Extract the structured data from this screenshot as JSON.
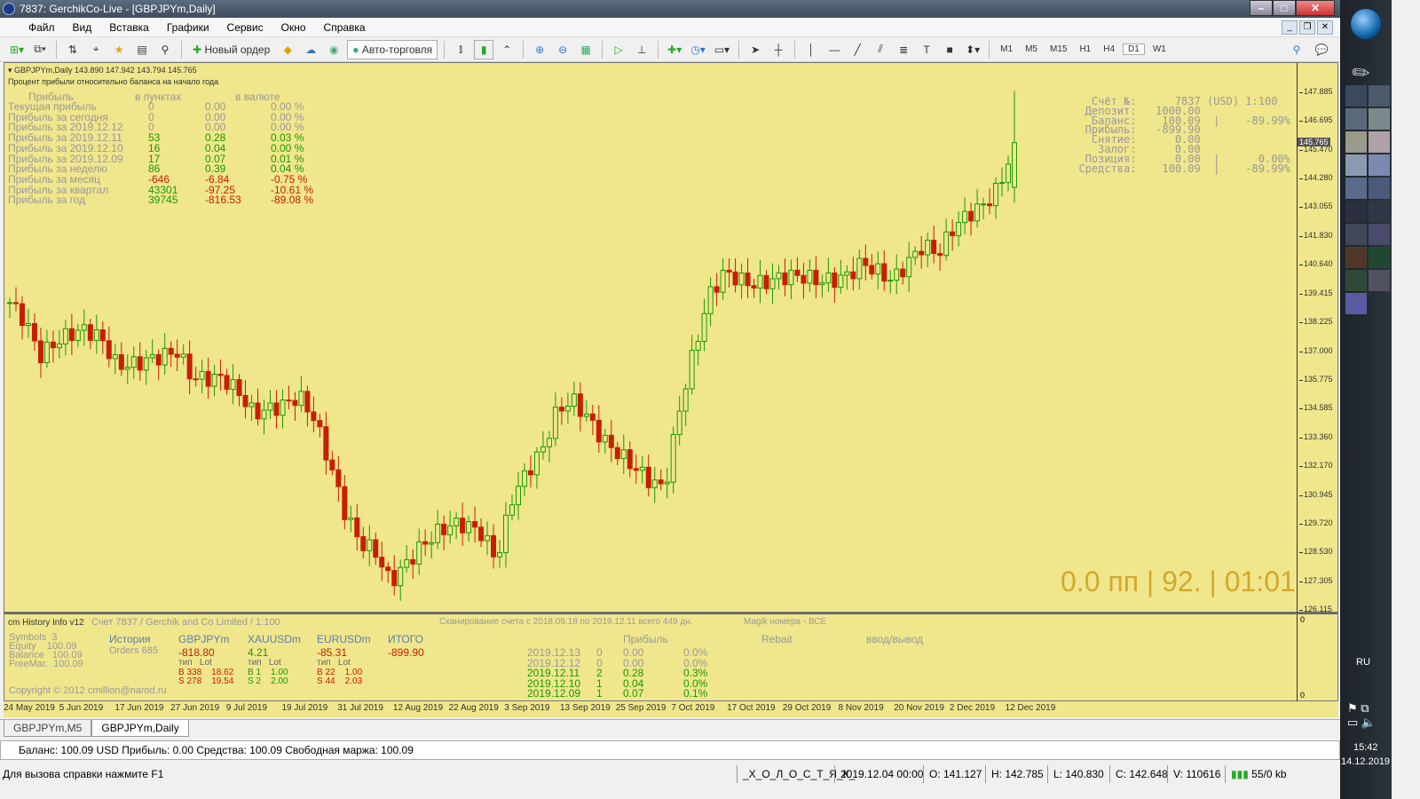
{
  "window": {
    "title": "7837: GerchikCo-Live - [GBPJPYm,Daily]"
  },
  "menu": [
    "Файл",
    "Вид",
    "Вставка",
    "Графики",
    "Сервис",
    "Окно",
    "Справка"
  ],
  "toolbar": {
    "new_order": "Новый ордер",
    "auto_trading": "Авто-торговля",
    "timeframes": [
      "M1",
      "M5",
      "M15",
      "H1",
      "H4",
      "D1",
      "W1"
    ],
    "active_timeframe": "D1"
  },
  "chart_header": {
    "symbol_line": "GBPJPYm,Daily  143.890 147.942 143.794 145.765",
    "subtitle": "Процент прибыли относительно баланса на начало года"
  },
  "profit_table": {
    "headers": [
      "Прибыль",
      "в пунктах",
      "в валюте"
    ],
    "rows": [
      {
        "label": "Текущая прибыль",
        "points": "0",
        "money": "0.00",
        "pct": "0.00 %",
        "tone": "g"
      },
      {
        "label": "Прибыль за сегодня",
        "points": "0",
        "money": "0.00",
        "pct": "0.00 %",
        "tone": "g"
      },
      {
        "label": "Прибыль за 2019.12.12",
        "points": "0",
        "money": "0.00",
        "pct": "0.00 %",
        "tone": "g"
      },
      {
        "label": "Прибыль за 2019.12.11",
        "points": "53",
        "money": "0.28",
        "pct": "0.03 %",
        "tone": "gr"
      },
      {
        "label": "Прибыль за 2019.12.10",
        "points": "16",
        "money": "0.04",
        "pct": "0.00 %",
        "tone": "gr"
      },
      {
        "label": "Прибыль за 2019.12.09",
        "points": "17",
        "money": "0.07",
        "pct": "0.01 %",
        "tone": "gr"
      },
      {
        "label": "Прибыль за неделю",
        "points": "86",
        "money": "0.39",
        "pct": "0.04 %",
        "tone": "gr"
      },
      {
        "label": "Прибыль за месяц",
        "points": "-646",
        "money": "-6.84",
        "pct": "-0.75 %",
        "tone": "rd"
      },
      {
        "label": "Прибыль за квартал",
        "points": "43301",
        "money": "-97.25",
        "pct": "-10.61 %",
        "tone": "mix"
      },
      {
        "label": "Прибыль за год",
        "points": "39745",
        "money": "-816.53",
        "pct": "-89.08 %",
        "tone": "mix"
      }
    ]
  },
  "account": {
    "lines": [
      "    Счёт №:      7837 (USD) 1:100",
      "   Депозит:   1000.00",
      "    Баланс:    100.09  |    -89.99%",
      "   Прибыль:   -899.90",
      "    Снятие:      0.00",
      "     Залог:      0.00",
      "   Позиция:      0.00  |      0.00%",
      "  Средства:    100.09  |    -89.99%"
    ]
  },
  "big_label": "0.0 пп | 92. | 01:01",
  "current_price": "145.765",
  "chart_data": {
    "type": "candlestick",
    "symbol": "GBPJPYm",
    "timeframe": "Daily",
    "ylim": [
      126.115,
      147.885
    ],
    "close_path": [
      139.04,
      138.29,
      136.8,
      137.36,
      137.73,
      137.91,
      137.54,
      136.42,
      136.42,
      136.61,
      136.8,
      136.98,
      135.86,
      135.86,
      135.86,
      135.3,
      134.37,
      134.55,
      134.74,
      135.11,
      134.18,
      132.31,
      130.26,
      128.95,
      128.58,
      127.27,
      128.02,
      128.77,
      129.33,
      129.7,
      129.7,
      129.33,
      128.21,
      130.82,
      131.94,
      132.87,
      134.55,
      134.93,
      134.18,
      133.25,
      132.69,
      132.13,
      131.57,
      131.2,
      134.55,
      137.17,
      139.41,
      140.34,
      139.97,
      139.79,
      139.97,
      140.16,
      140.16,
      139.97,
      139.97,
      140.16,
      140.72,
      140.34,
      139.97,
      140.72,
      141.46,
      141.09,
      142.21,
      142.77,
      143.14,
      143.89,
      145.765
    ],
    "y_ticks": [
      "147.885",
      "146.695",
      "145.470",
      "144.280",
      "143.055",
      "141.830",
      "140.640",
      "139.415",
      "138.225",
      "137.000",
      "135.775",
      "134.585",
      "133.360",
      "132.170",
      "130.945",
      "129.720",
      "128.530",
      "127.305",
      "126.115"
    ],
    "x_ticks": [
      "24 May 2019",
      "5 Jun 2019",
      "17 Jun 2019",
      "27 Jun 2019",
      "9 Jul 2019",
      "19 Jul 2019",
      "31 Jul 2019",
      "12 Aug 2019",
      "22 Aug 2019",
      "3 Sep 2019",
      "13 Sep 2019",
      "25 Sep 2019",
      "7 Oct 2019",
      "17 Oct 2019",
      "29 Oct 2019",
      "8 Nov 2019",
      "20 Nov 2019",
      "2 Dec 2019",
      "12 Dec 2019"
    ]
  },
  "sub": {
    "name": "cm History Info v12",
    "account": "Счет 7837 / Gerchik and Co Limited / 1:100",
    "scan": "Сканирование счета с 2018.09.18 по 2019.12.11 всего 449 дн.",
    "magic": "Magik номера - ВСЕ",
    "stats": [
      "Symbols  3",
      "Equity    100.09",
      "Balance   100.09",
      "FreeMar.  100.09"
    ],
    "copyright": "Copyright © 2012 cmillion@narod.ru",
    "history": "История",
    "orders": "Orders 685",
    "type_lot": "тип   Lot",
    "symbols": [
      {
        "name": "GBPJPYm",
        "total": "-818.80",
        "b": "B 338    18.62",
        "s": "S 278    19.54",
        "tone": "rd"
      },
      {
        "name": "XAUUSDm",
        "total": "4.21",
        "b": "B 1    1.00",
        "s": "S 2    2.00",
        "tone": "gr"
      },
      {
        "name": "EURUSDm",
        "total": "-85.31",
        "b": "B 22    1.00",
        "s": "S 44    2.03",
        "tone": "rd"
      }
    ],
    "total_label": "ИТОГО",
    "total": "-899.90",
    "profit_hdr": "Прибыль",
    "rebait": "Rebait",
    "inout": "ввод/вывод",
    "axis_top": "0",
    "axis_bottom": "0",
    "days": [
      {
        "d": "2019.12.13",
        "n": "0",
        "p": "0.00",
        "pc": "0.0%",
        "tone": "g"
      },
      {
        "d": "2019.12.12",
        "n": "0",
        "p": "0.00",
        "pc": "0.0%",
        "tone": "g"
      },
      {
        "d": "2019.12.11",
        "n": "2",
        "p": "0.28",
        "pc": "0.3%",
        "tone": "gr"
      },
      {
        "d": "2019.12.10",
        "n": "1",
        "p": "0.04",
        "pc": "0.0%",
        "tone": "gr"
      },
      {
        "d": "2019.12.09",
        "n": "1",
        "p": "0.07",
        "pc": "0.1%",
        "tone": "gr"
      }
    ]
  },
  "tabs": [
    "GBPJPYm,M5",
    "GBPJPYm,Daily"
  ],
  "terminal": "Баланс: 100.09 USD  Прибыль: 0.00  Средства: 100.09  Свободная маржа: 100.09",
  "status": {
    "help": "Для вызова справки нажмите F1",
    "profile": "_Х_О_Л_О_С_Т_Я_К_",
    "time": "2019.12.04 00:00",
    "o": "O: 141.127",
    "h": "H: 142.785",
    "l": "L: 140.830",
    "c": "C: 142.648",
    "v": "V: 110616",
    "traffic": "55/0 kb"
  },
  "taskbar": {
    "lang": "RU",
    "clock": "15:42",
    "date": "14.12.2019"
  },
  "colors": {
    "chart_bg": "#f0e68c",
    "bull": "#1a9a00",
    "bear": "#c81e00",
    "label": "#d4a82a"
  }
}
